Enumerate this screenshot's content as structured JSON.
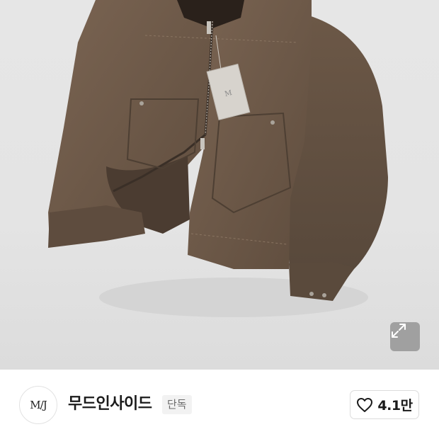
{
  "product": {
    "image_alt": "",
    "expand_icon": "expand-arrows-icon"
  },
  "shop": {
    "logo_text": "M/J",
    "name": "무드인사이드",
    "badge": "단독",
    "like_icon": "heart-icon",
    "like_count": "4.1만"
  },
  "colors": {
    "jacket_brown": "#6e5a48",
    "collar": "#2a211b",
    "background": "#e5e5e5"
  }
}
